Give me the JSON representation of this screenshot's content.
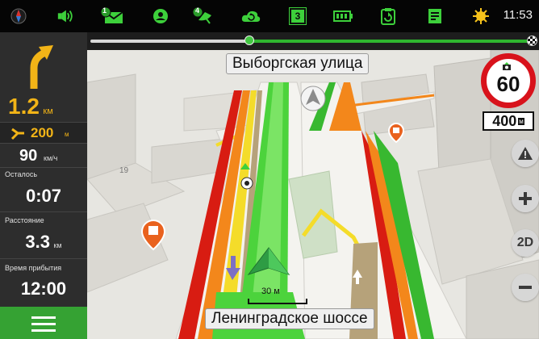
{
  "status_bar": {
    "icons": [
      "compass-icon",
      "volume-icon",
      "message-icon",
      "profile-icon",
      "gps-satellite-icon",
      "cloud-sync-icon",
      "route-count-icon",
      "battery-icon",
      "refresh-icon",
      "notes-icon",
      "weather-sun-icon"
    ],
    "message_badge": "1",
    "satellite_badge": "4",
    "route_count": "3",
    "time": "11:53"
  },
  "left_panel": {
    "turn_distance": "1.2",
    "turn_unit": "км",
    "next_turn_distance": "200",
    "next_turn_unit": "м",
    "speed": "90",
    "speed_unit": "км/ч",
    "remaining_label": "Осталось",
    "remaining_time": "0:07",
    "distance_label": "Расстояние",
    "distance_value": "3.3",
    "distance_unit": "км",
    "arrival_label": "Время прибытия",
    "arrival_time": "12:00"
  },
  "map": {
    "next_street": "Выборгская улица",
    "current_street": "Ленинградское шоссе",
    "speed_limit": "60",
    "distance_to_camera": "400",
    "distance_to_camera_unit": "м",
    "scale_label": "30 м",
    "house_number": "19",
    "zoom_mode": "2D"
  },
  "route_progress": 0.36,
  "colors": {
    "route": "#4cd33c",
    "panel": "#2a2a2a",
    "menu": "#35a233",
    "speed_limit_ring": "#d8121b",
    "traffic_red": "#d81c12",
    "traffic_orange": "#f3871b",
    "traffic_yellow": "#f4dc2a",
    "traffic_green": "#38b830"
  }
}
